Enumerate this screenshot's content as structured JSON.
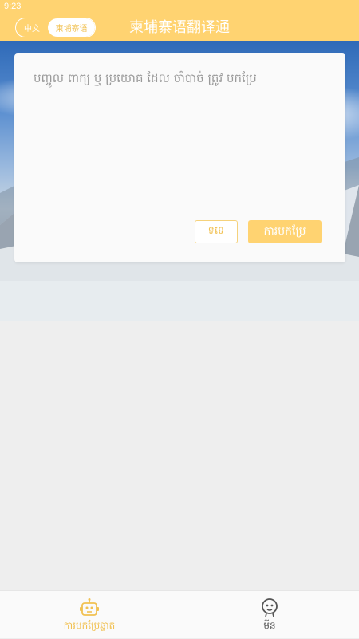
{
  "status_bar": {
    "time": "9:23"
  },
  "header": {
    "lang_toggle": {
      "left_label": "中文",
      "right_label": "柬埔寨语",
      "selected": "柬埔寨语"
    },
    "title": "柬埔寨语翻译通"
  },
  "translator": {
    "input_value": "",
    "input_placeholder": "បញ្ចូល ពាក្យ ឬ ប្រយោគ ដែល ចាំបាច់ ត្រូវ បកប្រែ",
    "clear_label": "ទទេ",
    "translate_label": "ការបកប្រែ"
  },
  "bottom_nav": {
    "items": [
      {
        "label": "ការបកប្រែឆ្លាត",
        "icon": "robot-icon",
        "active": true
      },
      {
        "label": "មីន",
        "icon": "person-icon",
        "active": false
      }
    ]
  },
  "colors": {
    "accent": "#ffd371",
    "accent_text": "#f1c152",
    "background": "#eeeeee"
  }
}
